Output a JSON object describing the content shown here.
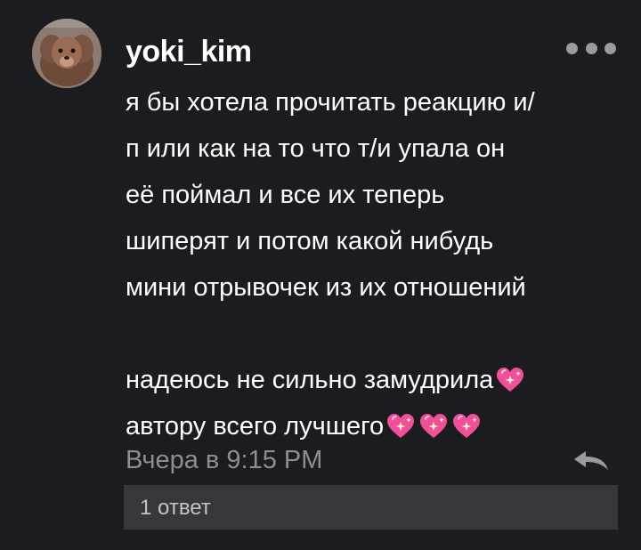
{
  "comment": {
    "username": "yoki_kim",
    "lines": [
      "я бы хотела прочитать реакцию и/",
      "п или как на то что т/и упала он",
      "её поймал и все их теперь",
      "шиперят и потом какой нибудь",
      "мини отрывочек из их отношений",
      "надеюсь не сильно замудрила",
      "автору всего лучшего"
    ],
    "emoji": "sparkling-heart",
    "timestamp": "Вчера в 9:15 PM",
    "replies_label": "1 ответ"
  },
  "colors": {
    "background": "#1c1b20",
    "text": "#ffffff",
    "muted": "#8d8d92",
    "replies_bg": "#37363b",
    "heart": "#f0509a"
  }
}
